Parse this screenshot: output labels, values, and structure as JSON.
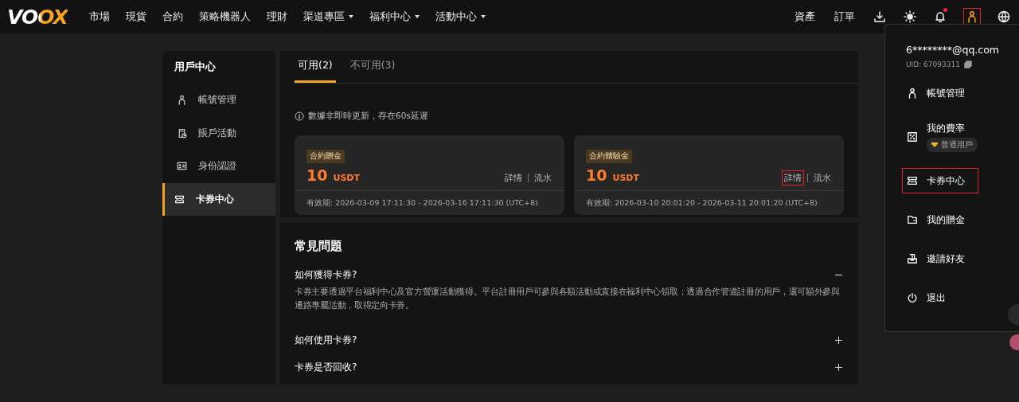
{
  "header": {
    "logo": "VOOX",
    "nav": [
      {
        "label": "市場",
        "has_menu": false
      },
      {
        "label": "現貨",
        "has_menu": false
      },
      {
        "label": "合約",
        "has_menu": false
      },
      {
        "label": "策略機器人",
        "has_menu": false
      },
      {
        "label": "理財",
        "has_menu": false
      },
      {
        "label": "渠道專區",
        "has_menu": true
      },
      {
        "label": "福利中心",
        "has_menu": true
      },
      {
        "label": "活動中心",
        "has_menu": true
      }
    ],
    "right_links": [
      "資產",
      "訂單"
    ],
    "notifications": {
      "unread": true
    },
    "user_button": {
      "highlighted": true
    }
  },
  "sidebar": {
    "title": "用戶中心",
    "items": [
      {
        "label": "帳號管理",
        "selected": false
      },
      {
        "label": "賬戶活動",
        "selected": false
      },
      {
        "label": "身份認證",
        "selected": false
      },
      {
        "label": "卡券中心",
        "selected": true
      }
    ]
  },
  "coupons": {
    "tabs": [
      {
        "label": "可用(2)",
        "selected": true
      },
      {
        "label": "不可用(3)",
        "selected": false
      }
    ],
    "notice": "數據非即時更新，存在60s延遲",
    "cards": [
      {
        "tag": "合約贈金",
        "amount": "10",
        "unit": "USDT",
        "links": [
          {
            "label": "詳情",
            "highlighted": false
          },
          {
            "label": "流水",
            "highlighted": false
          }
        ],
        "validity": "有效期: 2026-03-09 17:11:30 - 2026-03-16 17:11:30 (UTC+8)"
      },
      {
        "tag": "合約體驗金",
        "amount": "10",
        "unit": "USDT",
        "links": [
          {
            "label": "詳情",
            "highlighted": true
          },
          {
            "label": "流水",
            "highlighted": false
          }
        ],
        "validity": "有效期: 2026-03-10 20:01:20 - 2026-03-11 20:01:20 (UTC+8)"
      }
    ]
  },
  "faq": {
    "title": "常見問題",
    "items": [
      {
        "question": "如何獲得卡券?",
        "expanded": true,
        "answer": "卡券主要透過平台福利中心及官方營運活動獲得。平台註冊用戶可參與各類活動或直接在福利中心領取；透過合作管道註冊的用戶，還可額外參與通路專屬活動，取得定向卡券。"
      },
      {
        "question": "如何使用卡券?",
        "expanded": false
      },
      {
        "question": "卡券是否回收?",
        "expanded": false
      }
    ]
  },
  "user_menu": {
    "email": "6********@qq.com",
    "uid": "UID:  67093311",
    "items": [
      {
        "label": "帳號管理",
        "highlighted": false
      },
      {
        "label": "我的費率",
        "highlighted": false,
        "badge": "普通用戶"
      },
      {
        "label": "卡券中心",
        "highlighted": true
      },
      {
        "label": "我的贈金",
        "highlighted": false
      },
      {
        "label": "邀請好友",
        "highlighted": false
      },
      {
        "label": "退出",
        "highlighted": false
      }
    ]
  }
}
